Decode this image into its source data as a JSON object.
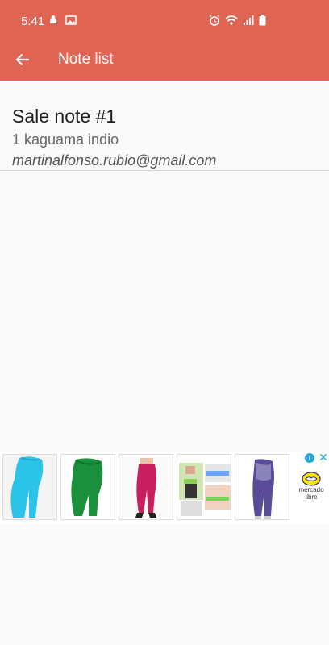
{
  "status_bar": {
    "time": "5:41",
    "left_icons": [
      "notification-icon",
      "image-icon"
    ],
    "right_icons": [
      "alarm-icon",
      "wifi-icon",
      "signal-icon",
      "battery-icon"
    ]
  },
  "app_bar": {
    "title": "Note list",
    "back_icon": "arrow-left-icon",
    "background_color": "#e06554"
  },
  "notes": [
    {
      "title": "Sale note #1",
      "description": "1 kaguama indio",
      "email": "martinalfonso.rubio@gmail.com"
    }
  ],
  "ad": {
    "products": [
      "leggings-cyan",
      "leggings-green",
      "leggings-magenta",
      "sport-belt",
      "leggings-purple"
    ],
    "advertiser_line1": "mercado",
    "advertiser_line2": "libre",
    "info_icon": "info-icon",
    "close_icon": "close-icon"
  }
}
